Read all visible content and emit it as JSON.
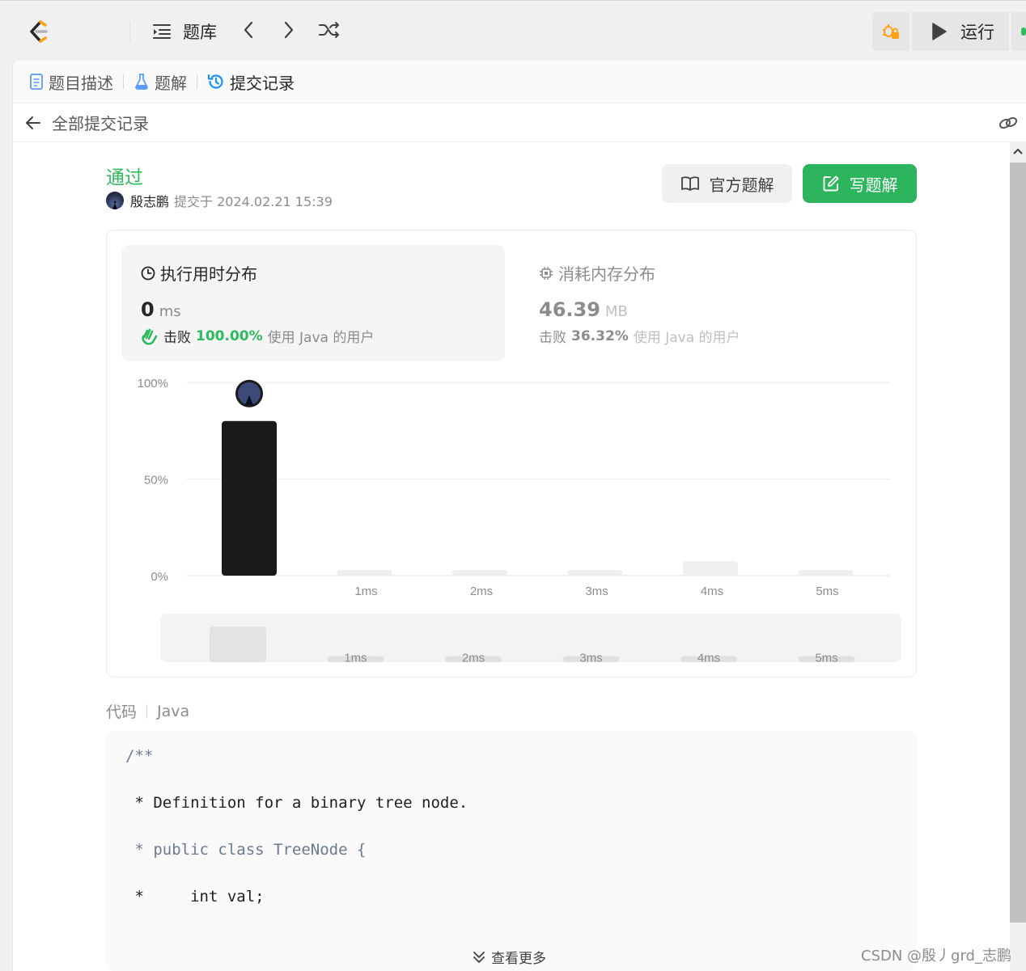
{
  "topbar": {
    "problem_list_label": "题库",
    "run_label": "运行"
  },
  "tabs": {
    "description": "题目描述",
    "solutions": "题解",
    "submissions": "提交记录"
  },
  "back": {
    "label": "全部提交记录"
  },
  "submission": {
    "status": "通过",
    "author": "殷志鹏",
    "submitted_text": "提交于 2024.02.21 15:39",
    "official_solution_label": "官方题解",
    "write_solution_label": "写题解"
  },
  "runtime": {
    "title": "执行用时分布",
    "value": "0",
    "unit": "ms",
    "beat_prefix": "击败",
    "beat_pct": "100.00%",
    "beat_suffix": "使用 Java 的用户"
  },
  "memory": {
    "title": "消耗内存分布",
    "value": "46.39",
    "unit": "MB",
    "beat_prefix": "击败",
    "beat_pct": "36.32%",
    "beat_suffix": "使用 Java 的用户"
  },
  "chart_data": {
    "type": "bar",
    "categories": [
      "0ms",
      "1ms",
      "2ms",
      "3ms",
      "4ms",
      "5ms"
    ],
    "tick_labels": [
      "",
      "1ms",
      "2ms",
      "3ms",
      "4ms",
      "5ms"
    ],
    "values": [
      80,
      3,
      3,
      3,
      7.5,
      3
    ],
    "ylim": [
      0,
      100
    ],
    "yticks": [
      "100%",
      "50%",
      "0%"
    ],
    "highlight_index": 0,
    "colors": {
      "highlight": "#1a1a1a",
      "bar": "#efefef",
      "grid": "#eeeeee",
      "label": "#8c8c8c"
    },
    "overview_values": [
      18,
      3,
      3,
      3,
      3,
      3
    ]
  },
  "code": {
    "label": "代码",
    "language": "Java",
    "lines": [
      "/**",
      " * Definition for a binary tree node.",
      " * public class TreeNode {",
      " *     int val;"
    ],
    "more_label": "查看更多"
  },
  "watermark": "CSDN @殷丿grd_志鹏",
  "colors": {
    "accent_green": "#2cbb5d",
    "button_green": "#2db55d"
  }
}
